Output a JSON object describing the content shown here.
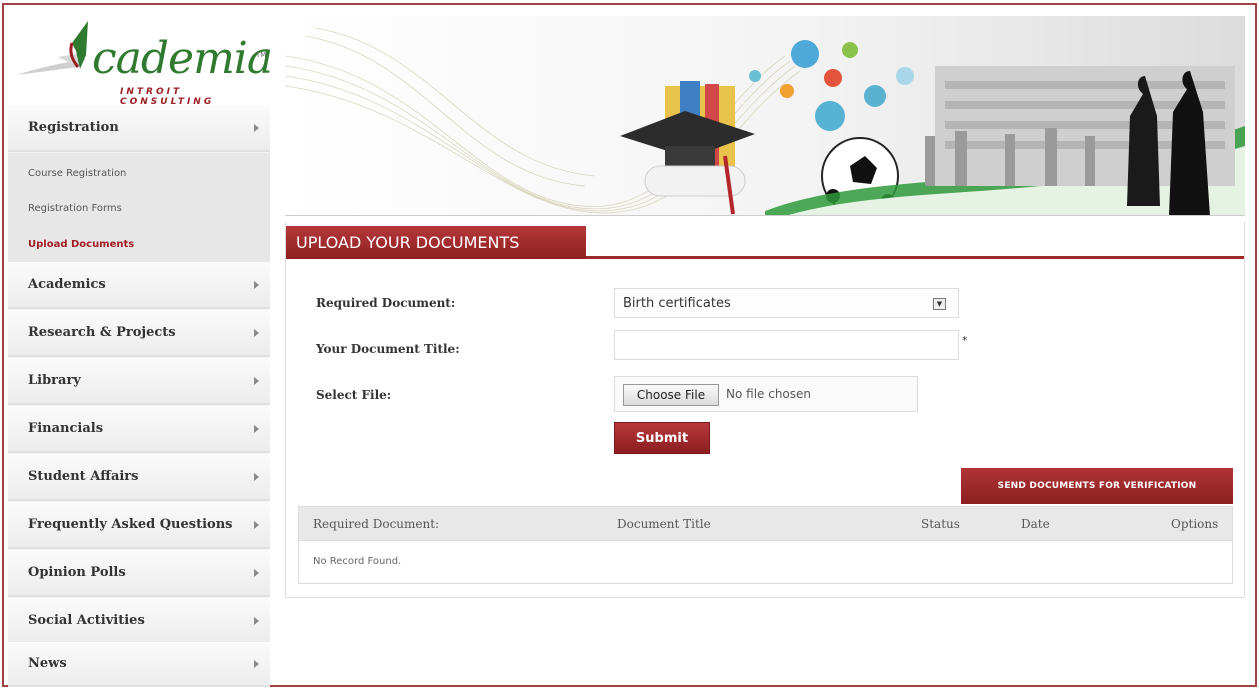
{
  "brand": {
    "name": "cademia",
    "tm": "TM",
    "subtitle": "INTROIT CONSULTING",
    "colors": {
      "accent": "#9e2b2b",
      "brand_green": "#2f7a2f"
    }
  },
  "sidebar": {
    "items": [
      {
        "label": "Registration"
      },
      {
        "label": "Academics"
      },
      {
        "label": "Research & Projects"
      },
      {
        "label": "Library"
      },
      {
        "label": "Financials"
      },
      {
        "label": "Student Affairs"
      },
      {
        "label": "Frequently Asked Questions"
      },
      {
        "label": "Opinion Polls"
      },
      {
        "label": "Social Activities"
      },
      {
        "label": "News"
      }
    ],
    "submenu": [
      {
        "label": "Course Registration"
      },
      {
        "label": "Registration Forms"
      },
      {
        "label": "Upload Documents"
      }
    ]
  },
  "main": {
    "tab_title": "UPLOAD YOUR DOCUMENTS",
    "form": {
      "required_document_label": "Required Document:",
      "required_document_value": "Birth certificates",
      "title_label": "Your Document Title:",
      "title_value": "",
      "required_marker": "*",
      "file_label": "Select File:",
      "choose_file_label": "Choose File",
      "no_file_text": "No file chosen",
      "submit_label": "Submit"
    },
    "verify_label": "SEND DOCUMENTS FOR VERIFICATION",
    "table": {
      "columns": [
        "Required Document:",
        "Document Title",
        "Status",
        "Date",
        "Options"
      ],
      "empty_text": "No Record Found."
    }
  }
}
